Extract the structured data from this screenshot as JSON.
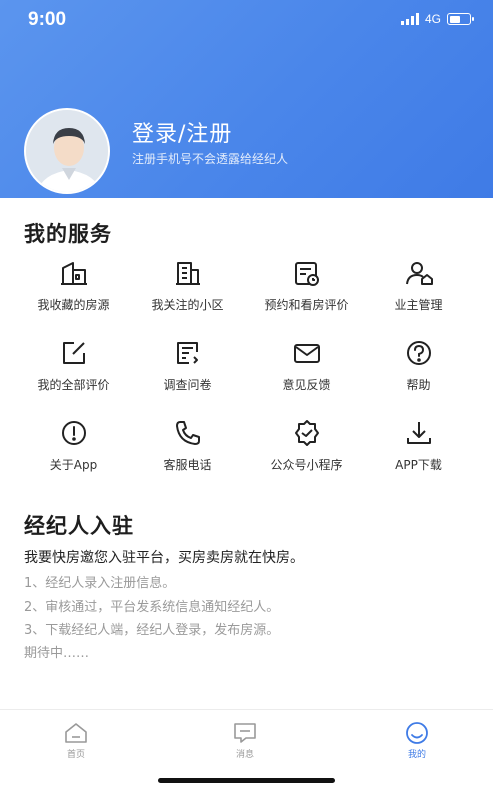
{
  "status_bar": {
    "time": "9:00",
    "network": "4G"
  },
  "profile": {
    "login_label": "登录/注册",
    "login_hint": "注册手机号不会透露给经纪人"
  },
  "services": {
    "title": "我的服务",
    "items": [
      {
        "label": "我收藏的房源",
        "icon": "house-icon"
      },
      {
        "label": "我关注的小区",
        "icon": "building-icon"
      },
      {
        "label": "预约和看房评价",
        "icon": "calendar-icon"
      },
      {
        "label": "业主管理",
        "icon": "owner-icon"
      },
      {
        "label": "我的全部评价",
        "icon": "edit-icon"
      },
      {
        "label": "调查问卷",
        "icon": "survey-icon"
      },
      {
        "label": "意见反馈",
        "icon": "mail-icon"
      },
      {
        "label": "帮助",
        "icon": "help-icon"
      },
      {
        "label": "关于App",
        "icon": "info-icon"
      },
      {
        "label": "客服电话",
        "icon": "phone-icon"
      },
      {
        "label": "公众号小程序",
        "icon": "badge-icon"
      },
      {
        "label": "APP下载",
        "icon": "download-icon"
      }
    ]
  },
  "agent": {
    "title": "经纪人入驻",
    "intro": "我要快房邀您入驻平台，买房卖房就在快房。",
    "steps": [
      "1、经纪人录入注册信息。",
      "2、审核通过，平台发系统信息通知经纪人。",
      "3、下载经纪人端，经纪人登录，发布房源。",
      "期待中……"
    ]
  },
  "tabbar": {
    "tabs": [
      {
        "label": "首页",
        "icon": "home-icon",
        "active": false
      },
      {
        "label": "消息",
        "icon": "message-icon",
        "active": false
      },
      {
        "label": "我的",
        "icon": "profile-icon",
        "active": true
      }
    ]
  },
  "colors": {
    "accent": "#3f7be6",
    "header_start": "#5b95ee",
    "text_muted": "#9a9a9a"
  }
}
